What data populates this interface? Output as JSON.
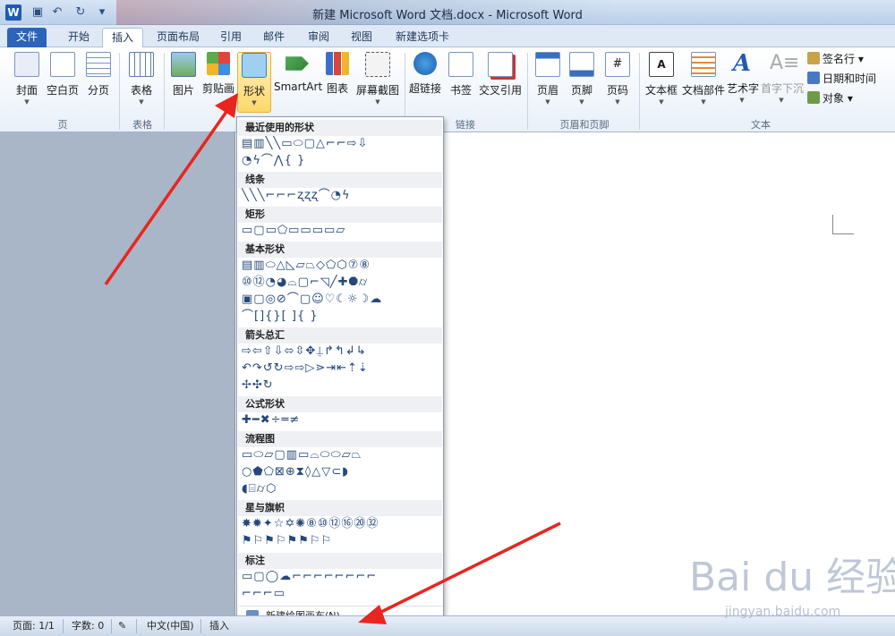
{
  "titlebar": {
    "title": "新建 Microsoft Word 文档.docx - Microsoft Word",
    "logo": "W",
    "qat_icons": [
      "save-icon",
      "undo-icon",
      "redo-icon",
      "customize-qat-icon"
    ]
  },
  "tabs": [
    "文件",
    "开始",
    "插入",
    "页面布局",
    "引用",
    "邮件",
    "审阅",
    "视图",
    "新建选项卡"
  ],
  "ribbon": {
    "buttons": [
      "封面",
      "空白页",
      "分页",
      "表格",
      "图片",
      "剪贴画",
      "形状",
      "SmartArt",
      "图表",
      "屏幕截图",
      "超链接",
      "书签",
      "交叉引用",
      "页眉",
      "页脚",
      "页码",
      "文本框",
      "文档部件",
      "艺术字",
      "首字下沉"
    ],
    "small_buttons": [
      "签名行",
      "日期和时间",
      "对象"
    ],
    "groups": [
      "页",
      "表格",
      "链接",
      "页眉和页脚",
      "文本"
    ],
    "colors": {
      "accent": "#2b64b8",
      "highlight": "#fdd86a"
    }
  },
  "shapes_menu": {
    "sections": [
      {
        "title": "最近使用的形状",
        "rows": [
          "▤▥╲╲▭⬭▢△⌐⌐⇨⇩",
          "◔ϟ⌒⋀{ }"
        ]
      },
      {
        "title": "线条",
        "rows": [
          "╲╲╲⌐⌐⌐ʐʐʐ⌒◔ϟ"
        ]
      },
      {
        "title": "矩形",
        "rows": [
          "▭▢▭⬠▭▭▭▭▱"
        ]
      },
      {
        "title": "基本形状",
        "rows": [
          "▤▥⬭△◺▱⏢◇⬠⬡⑦⑧",
          "⑩⑫◔◕⌓▢⌐◹╱✚⯃⌭",
          "▣▢◎⊘⌒▢☺♡☾☼☽☁",
          "⌒[]{}[ ]{ }"
        ]
      },
      {
        "title": "箭头总汇",
        "rows": [
          "⇨⇦⇧⇩⬄⇳✥⍊↱↰↲↳",
          "↶↷↺↻⇨⇨▷⋗⇥⇤⇡⇣",
          "✢✣↻"
        ]
      },
      {
        "title": "公式形状",
        "rows": [
          "✚━✖÷═≠"
        ]
      },
      {
        "title": "流程图",
        "rows": [
          "▭⬭▱▢▥▭⌓⬭⬭▱⏢",
          "○⬟⬠⊠⊕⧗◊△▽⊂◗",
          "◖⌸⌭⬡"
        ]
      },
      {
        "title": "星与旗帜",
        "rows": [
          "✸✹✦☆✡✺⑧⑩⑫⑯⑳㉜",
          "⚑⚐⚑⚐⚑⚑⚐⚐"
        ]
      },
      {
        "title": "标注",
        "rows": [
          "▭▢◯☁⌐⌐⌐⌐⌐⌐⌐⌐",
          "⌐⌐⌐▭"
        ]
      }
    ],
    "new_canvas": "新建绘图画布(N)"
  },
  "statusbar": {
    "page": "页面: 1/1",
    "words": "字数: 0",
    "language": "中文(中国)",
    "mode": "插入"
  },
  "watermark": {
    "brand": "Bai du 经验",
    "url": "jingyan.baidu.com"
  }
}
